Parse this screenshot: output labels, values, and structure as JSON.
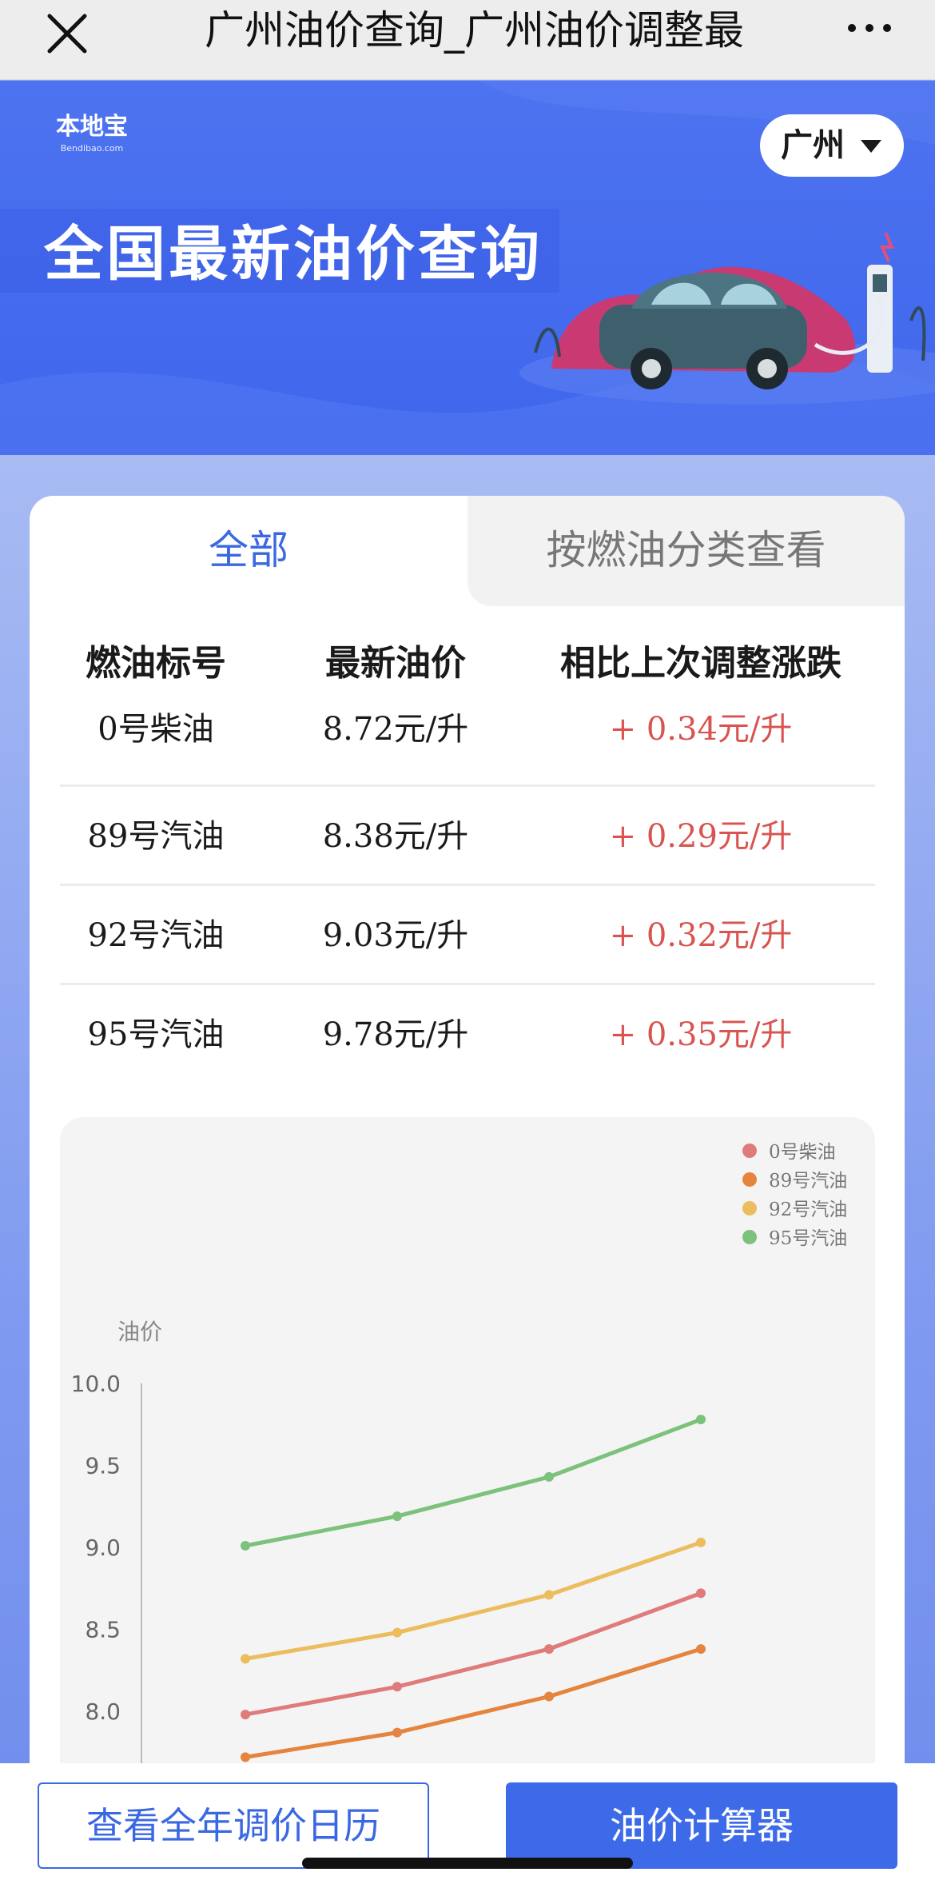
{
  "nav": {
    "title": "广州油价查询_广州油价调整最",
    "close_icon": "close-icon",
    "more_icon": "more-icon"
  },
  "banner": {
    "logo_text": "本地宝",
    "logo_sub": "Bendibao.com",
    "city": "广州",
    "title": "全国最新油价查询"
  },
  "tabs": [
    {
      "label": "全部",
      "active": true
    },
    {
      "label": "按燃油分类查看",
      "active": false
    }
  ],
  "table": {
    "headers": [
      "燃油标号",
      "最新油价",
      "相比上次调整涨跌"
    ],
    "rows": [
      {
        "type": "0号柴油",
        "price": "8.72元/升",
        "change": "+ 0.34元/升"
      },
      {
        "type": "89号汽油",
        "price": "8.38元/升",
        "change": "+ 0.29元/升"
      },
      {
        "type": "92号汽油",
        "price": "9.03元/升",
        "change": "+ 0.32元/升"
      },
      {
        "type": "95号汽油",
        "price": "9.78元/升",
        "change": "+ 0.35元/升"
      }
    ]
  },
  "chart_data": {
    "type": "line",
    "title": "",
    "xlabel": "",
    "ylabel": "油价",
    "ylim": [
      7.8,
      10.0
    ],
    "y_ticks": [
      "10.0",
      "9.5",
      "9.0",
      "8.5",
      "8.0"
    ],
    "legend_position": "top-right",
    "grid": false,
    "series": [
      {
        "name": "0号柴油",
        "color": "#e07b7b",
        "values": [
          7.98,
          8.15,
          8.38,
          8.72
        ]
      },
      {
        "name": "89号汽油",
        "color": "#e5843e",
        "values": [
          7.72,
          7.87,
          8.09,
          8.38
        ]
      },
      {
        "name": "92号汽油",
        "color": "#ebbd5e",
        "values": [
          8.32,
          8.48,
          8.71,
          9.03
        ]
      },
      {
        "name": "95号汽油",
        "color": "#7cc27c",
        "values": [
          9.01,
          9.19,
          9.43,
          9.78
        ]
      }
    ]
  },
  "bottom": {
    "calendar_label": "查看全年调价日历",
    "calculator_label": "油价计算器"
  }
}
